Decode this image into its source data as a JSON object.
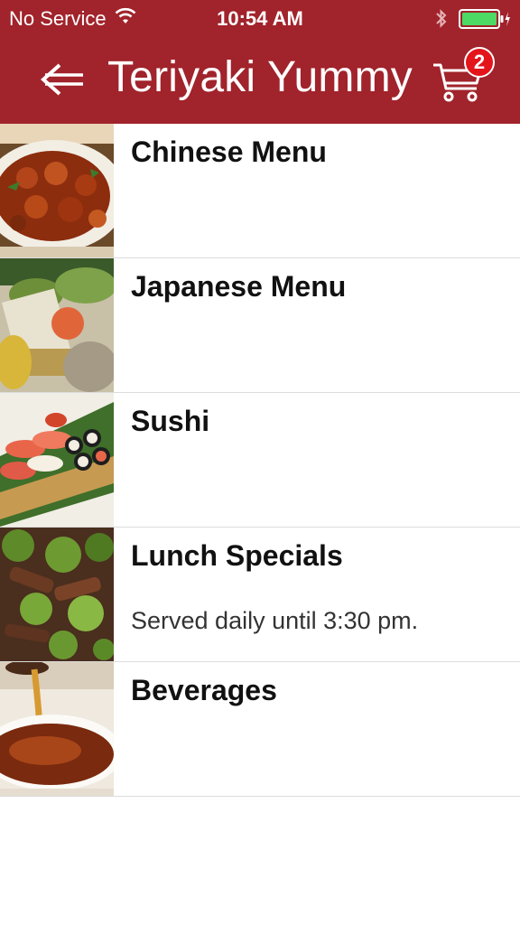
{
  "status_bar": {
    "carrier": "No Service",
    "time": "10:54 AM",
    "wifi_icon": "wifi-icon",
    "bluetooth_icon": "bluetooth-icon",
    "battery_icon": "battery-charging-icon",
    "battery_color": "#4cd964"
  },
  "nav": {
    "title": "Teriyaki Yummy",
    "back_icon": "back-arrow-icon",
    "cart_icon": "cart-icon",
    "cart_count": "2",
    "bar_color": "#a1232b",
    "badge_color": "#e4141b"
  },
  "menu": {
    "items": [
      {
        "title": "Chinese Menu",
        "subtitle": "",
        "image": "orange-chicken-photo"
      },
      {
        "title": "Japanese Menu",
        "subtitle": "",
        "image": "teriyaki-bowl-photo"
      },
      {
        "title": "Sushi",
        "subtitle": "",
        "image": "sushi-platter-photo"
      },
      {
        "title": "Lunch Specials",
        "subtitle": "Served daily until 3:30 pm.",
        "image": "beef-broccoli-photo"
      },
      {
        "title": "Beverages",
        "subtitle": "",
        "image": "tea-cup-photo"
      }
    ]
  }
}
